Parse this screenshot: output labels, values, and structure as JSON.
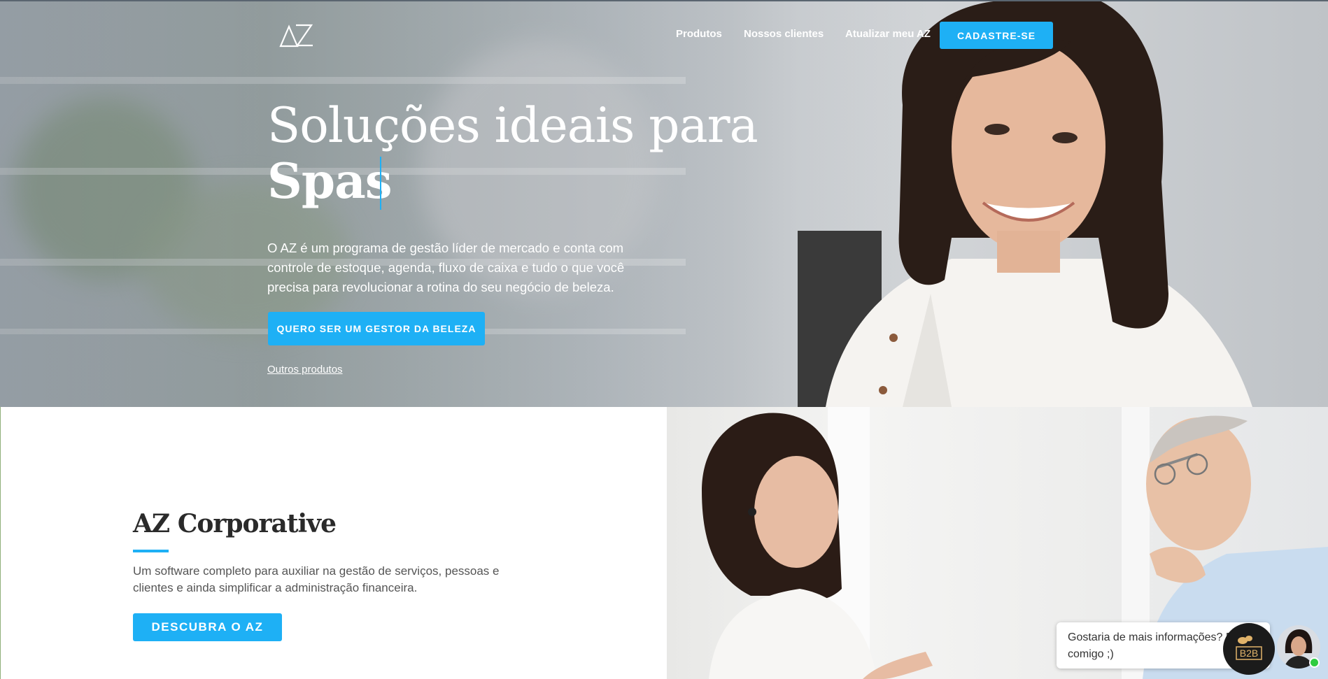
{
  "header": {
    "logo_text": "AZ",
    "nav": [
      {
        "label": "Produtos"
      },
      {
        "label": "Nossos clientes"
      },
      {
        "label": "Atualizar meu AZ"
      }
    ],
    "signup_label": "CADASTRE-SE"
  },
  "hero": {
    "title_line1": "Soluções ideais para",
    "title_line2": "Spas",
    "description": "O AZ é um programa de gestão líder de mercado e conta com controle de estoque, agenda, fluxo de caixa e tudo o que você precisa para revolucionar a rotina do seu negócio de beleza.",
    "cta_label": "QUERO SER UM GESTOR DA BELEZA",
    "other_link": "Outros produtos"
  },
  "corporate": {
    "title": "AZ Corporative",
    "description": "Um software completo para auxiliar na gestão de serviços, pessoas e clientes e ainda simplificar a administração financeira.",
    "button_label": "DESCUBRA O AZ"
  },
  "chat": {
    "message": "Gostaria de mais informações? Fale comigo ;)",
    "badge_text": "B2B",
    "status": "online"
  },
  "colors": {
    "accent": "#1eb0f5",
    "heading_dark": "#2a2a2a",
    "text_gray": "#555555",
    "online_green": "#2ecc40"
  }
}
